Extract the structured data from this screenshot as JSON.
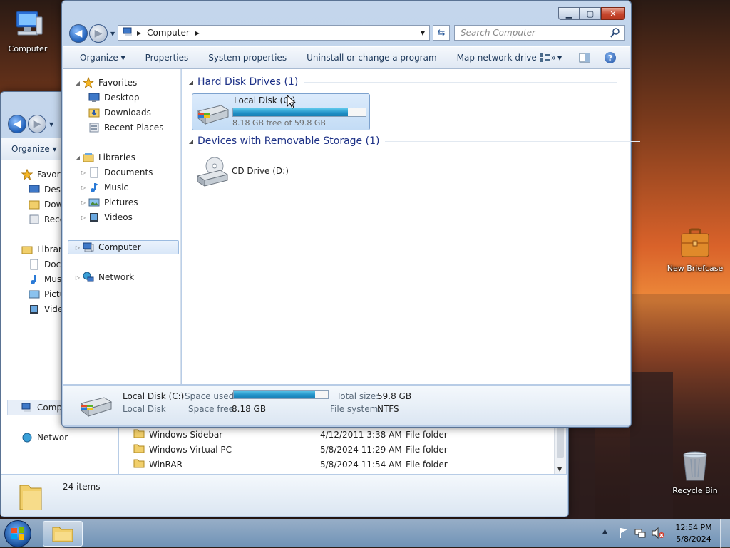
{
  "desktop": {
    "icons": [
      {
        "label": "Computer",
        "name": "computer"
      },
      {
        "label": "New Briefcase",
        "name": "briefcase"
      },
      {
        "label": "Recycle Bin",
        "name": "recycle-bin"
      }
    ]
  },
  "back_window": {
    "toolbar": {
      "organize": "Organize"
    },
    "nav": [
      {
        "label": "Favorit",
        "icon": "star-icon"
      },
      {
        "label": "Deskt",
        "icon": "desktop-icon"
      },
      {
        "label": "Down",
        "icon": "downloads-icon"
      },
      {
        "label": "Recer",
        "icon": "recent-places-icon"
      },
      {
        "label": "Librarie",
        "icon": "libraries-icon"
      },
      {
        "label": "Docu",
        "icon": "documents-icon"
      },
      {
        "label": "Musi",
        "icon": "music-icon"
      },
      {
        "label": "Pictu",
        "icon": "pictures-icon"
      },
      {
        "label": "Video",
        "icon": "videos-icon"
      },
      {
        "label": "Compu",
        "icon": "computer-icon"
      },
      {
        "label": "Networ",
        "icon": "network-icon"
      }
    ],
    "files": [
      {
        "name": "Windows Sidebar",
        "date": "4/12/2011 3:38 AM",
        "type": "File folder"
      },
      {
        "name": "Windows Virtual PC",
        "date": "5/8/2024 11:29 AM",
        "type": "File folder"
      },
      {
        "name": "WinRAR",
        "date": "5/8/2024 11:54 AM",
        "type": "File folder"
      }
    ],
    "status": "24 items"
  },
  "explorer": {
    "address": {
      "root": "Computer"
    },
    "search_placeholder": "Search Computer",
    "toolbar": {
      "organize": "Organize",
      "properties": "Properties",
      "system_properties": "System properties",
      "uninstall": "Uninstall or change a program",
      "map_drive": "Map network drive",
      "more": "»"
    },
    "nav": {
      "favorites": "Favorites",
      "desktop": "Desktop",
      "downloads": "Downloads",
      "recent": "Recent Places",
      "libraries": "Libraries",
      "documents": "Documents",
      "music": "Music",
      "pictures": "Pictures",
      "videos": "Videos",
      "computer": "Computer",
      "network": "Network"
    },
    "groups": {
      "hdd": "Hard Disk Drives (1)",
      "removable": "Devices with Removable Storage (1)"
    },
    "drives": {
      "c_name": "Local Disk (C:)",
      "c_free": "8.18 GB free of 59.8 GB",
      "c_used_fraction": 0.863,
      "d_name": "CD Drive (D:)"
    },
    "details": {
      "name": "Local Disk (C:)",
      "type": "Local Disk",
      "space_used_label": "Space used:",
      "space_free_label": "Space free:",
      "space_free": "8.18 GB",
      "total_size_label": "Total size:",
      "total_size": "59.8 GB",
      "fs_label": "File system:",
      "fs": "NTFS"
    }
  },
  "taskbar": {
    "time": "12:54 PM",
    "date": "5/8/2024"
  }
}
